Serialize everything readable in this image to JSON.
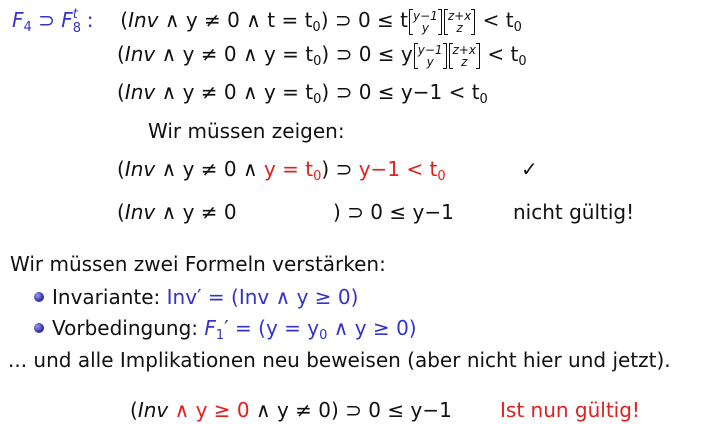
{
  "formula_block": {
    "lhs_label": "F",
    "lhs_sub": "4",
    "supset": "⊃",
    "rhs_label": "F",
    "rhs_sub": "8",
    "rhs_sup": "t",
    "colon": ":",
    "line1": {
      "open": "(",
      "inv": "Inv",
      "and_y_ne_0": " ∧ y ≠ 0 ∧ ",
      "cond": "t = t",
      "cond_sub": "0",
      "close": ")",
      "impl": " ⊃ 0 ≤ t",
      "sub1_top": "y−1",
      "sub1_bot": "y",
      "sub2_top": "z+x",
      "sub2_bot": "z",
      "lt": " < t",
      "lt_sub": "0"
    },
    "line2": {
      "open": "(",
      "inv": "Inv",
      "and_y_ne_0": " ∧ y ≠ 0 ∧ ",
      "cond": "y = t",
      "cond_sub": "0",
      "close": ")",
      "impl": " ⊃ 0 ≤ y",
      "sub1_top": "y−1",
      "sub1_bot": "y",
      "sub2_top": "z+x",
      "sub2_bot": "z",
      "lt": " < t",
      "lt_sub": "0"
    },
    "line3": {
      "open": "(",
      "inv": "Inv",
      "and_y_ne_0": " ∧ y ≠ 0 ∧ ",
      "cond": "y = t",
      "cond_sub": "0",
      "close": ")",
      "impl": " ⊃ 0 ≤ y−1 < t",
      "impl_sub": "0"
    }
  },
  "show_label": "Wir müssen zeigen:",
  "show_line1": {
    "open": "(",
    "inv": "Inv",
    "and_part": " ∧ y ≠ 0 ∧ ",
    "red_cond": "y = t",
    "red_cond_sub": "0",
    "close": ")",
    "impl": " ⊃ ",
    "red_result": "y−1 < t",
    "red_result_sub": "0",
    "check": "✓"
  },
  "show_line2": {
    "open": "(",
    "inv": "Inv",
    "and_part": " ∧ y ≠ 0",
    "close": ")",
    "impl": " ⊃ 0 ≤ y−1",
    "verdict": "nicht gültig!"
  },
  "strengthen_label": "Wir müssen zwei Formeln verstärken:",
  "bullets": [
    {
      "label": "Invariante: ",
      "blue_text": "Inv′ = (Inv ∧ y ≥ 0)"
    },
    {
      "label": "Vorbedingung: ",
      "blue_F": "F",
      "blue_F_sub": "1",
      "blue_rest": "′ = (y = y",
      "blue_y_sub": "0",
      "blue_end": " ∧ y ≥ 0)"
    }
  ],
  "proof_note": "... und alle Implikationen neu beweisen (aber nicht hier und jetzt).",
  "final_line": {
    "open": "(",
    "inv": "Inv",
    "red_part": " ∧ y ≥ 0",
    "and_part": " ∧ y ≠ 0",
    "close": ")",
    "impl": " ⊃ 0 ≤ y−1",
    "red_verdict": "Ist nun gültig!"
  }
}
